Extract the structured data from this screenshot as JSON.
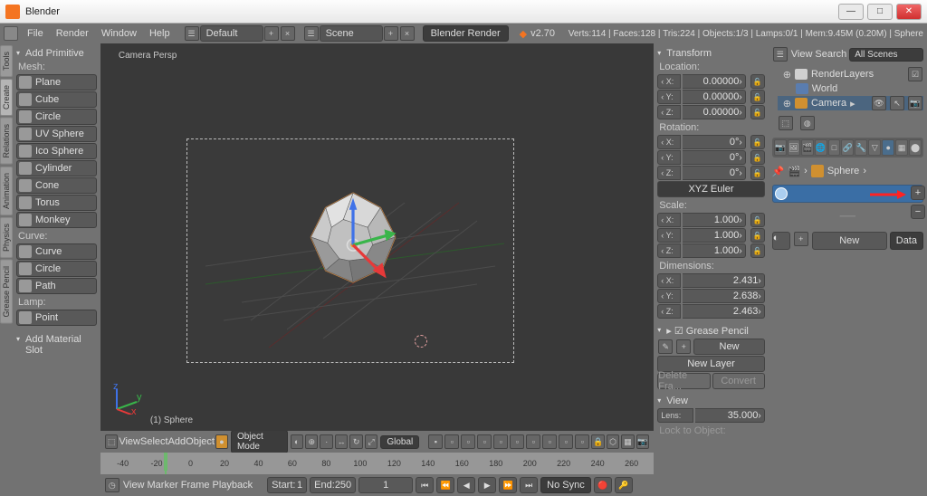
{
  "window": {
    "title": "Blender"
  },
  "menu": {
    "file": "File",
    "render": "Render",
    "window": "Window",
    "help": "Help"
  },
  "layout_field": "Default",
  "scene_field": "Scene",
  "engine": "Blender Render",
  "version": "v2.70",
  "stats": "Verts:114 | Faces:128 | Tris:224 | Objects:1/3 | Lamps:0/1 | Mem:9.45M (0.20M) | Sphere",
  "vert_tabs": [
    "Tools",
    "Create",
    "Relations",
    "Animation",
    "Physics",
    "Grease Pencil"
  ],
  "toolshelf": {
    "header": "Add Primitive",
    "mesh_label": "Mesh:",
    "mesh_items": [
      "Plane",
      "Cube",
      "Circle",
      "UV Sphere",
      "Ico Sphere",
      "Cylinder",
      "Cone",
      "Torus",
      "Monkey"
    ],
    "curve_label": "Curve:",
    "curve_items": [
      "Curve",
      "Circle",
      "Path"
    ],
    "lamp_label": "Lamp:",
    "lamp_items": [
      "Point"
    ],
    "last_op": "Add Material Slot"
  },
  "viewport": {
    "persp_label": "Camera Persp",
    "object_label": "(1) Sphere"
  },
  "vp_header": {
    "view": "View",
    "select": "Select",
    "add": "Add",
    "object": "Object",
    "mode": "Object Mode",
    "orient": "Global"
  },
  "transform": {
    "header": "Transform",
    "loc_label": "Location:",
    "loc": {
      "x": "0.00000",
      "y": "0.00000",
      "z": "0.00000"
    },
    "rot_label": "Rotation:",
    "rot": {
      "x": "0°",
      "y": "0°",
      "z": "0°"
    },
    "rot_mode": "XYZ Euler",
    "scale_label": "Scale:",
    "scale": {
      "x": "1.000",
      "y": "1.000",
      "z": "1.000"
    },
    "dim_label": "Dimensions:",
    "dim": {
      "x": "2.431",
      "y": "2.638",
      "z": "2.463"
    }
  },
  "gp": {
    "header": "Grease Pencil",
    "new": "New",
    "new_layer": "New Layer",
    "del": "Delete Fra...",
    "conv": "Convert"
  },
  "view_panel": {
    "header": "View",
    "lens_label": "Lens:",
    "lens_val": "35.000",
    "lock": "Lock to Object:"
  },
  "timeline": {
    "ticks": [
      "-40",
      "-20",
      "0",
      "20",
      "40",
      "60",
      "80",
      "100",
      "120",
      "140",
      "160",
      "180",
      "200",
      "220",
      "240",
      "260"
    ],
    "view": "View",
    "marker": "Marker",
    "frame": "Frame",
    "playback": "Playback",
    "start_label": "Start:",
    "start": "1",
    "end_label": "End:",
    "end": "250",
    "cur": "1",
    "sync": "No Sync"
  },
  "outliner": {
    "view": "View",
    "search": "Search",
    "dd": "All Scenes",
    "items": [
      {
        "label": "RenderLayers"
      },
      {
        "label": "World"
      },
      {
        "label": "Camera"
      }
    ]
  },
  "breadcrumb": {
    "obj": "Sphere"
  },
  "material": {
    "new": "New",
    "data": "Data"
  }
}
